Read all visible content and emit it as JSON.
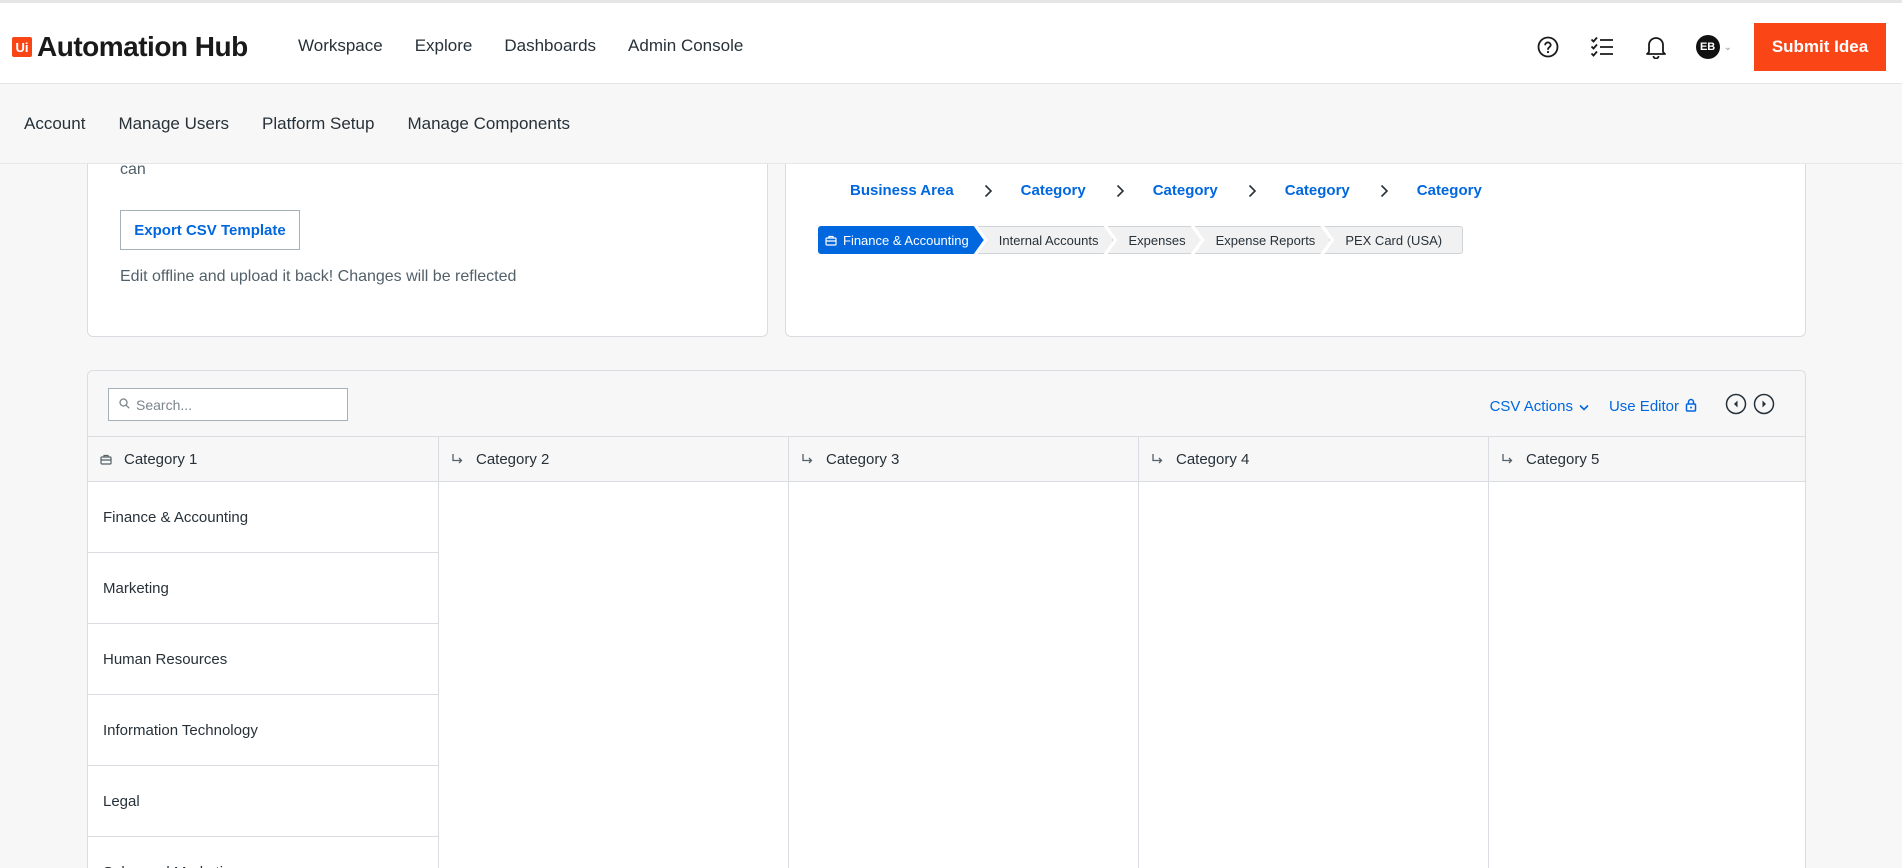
{
  "app": {
    "logo_badge": "Ui",
    "logo_text": "Automation Hub"
  },
  "nav": [
    "Workspace",
    "Explore",
    "Dashboards",
    "Admin Console"
  ],
  "user": {
    "initials": "EB"
  },
  "submit_label": "Submit Idea",
  "subnav": [
    "Account",
    "Manage Users",
    "Platform Setup",
    "Manage Components"
  ],
  "left_card": {
    "cut_line": "can",
    "export_label": "Export CSV Template",
    "edit_text": "Edit offline and upload it back! Changes will be reflected"
  },
  "breadcrumb": [
    "Business Area",
    "Category",
    "Category",
    "Category",
    "Category"
  ],
  "chips": [
    "Finance & Accounting",
    "Internal Accounts",
    "Expenses",
    "Expense Reports",
    "PEX Card (USA)"
  ],
  "toolbar": {
    "search_placeholder": "Search...",
    "csv_actions": "CSV Actions",
    "use_editor": "Use Editor"
  },
  "columns": [
    "Category 1",
    "Category 2",
    "Category 3",
    "Category 4",
    "Category 5"
  ],
  "category1_rows": [
    "Finance & Accounting",
    "Marketing",
    "Human Resources",
    "Information Technology",
    "Legal",
    "Sales and Marketing"
  ],
  "colors": {
    "brand": "#fa4616",
    "link": "#0067df"
  }
}
